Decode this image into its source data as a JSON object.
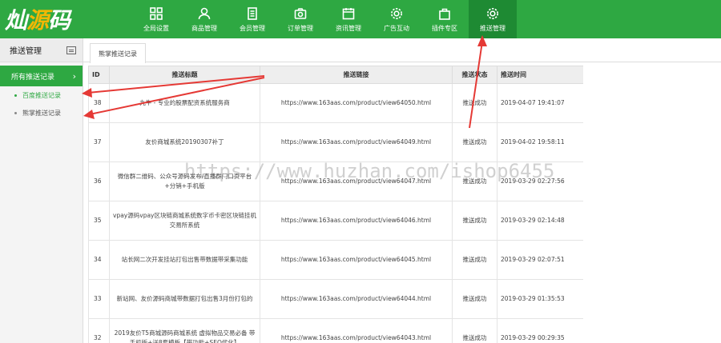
{
  "logo": {
    "part1": "灿",
    "part2": "源",
    "part3": "码"
  },
  "nav": [
    {
      "label": "全局设置",
      "icon": "grid-icon",
      "active": false
    },
    {
      "label": "商品管理",
      "icon": "user-icon",
      "active": false
    },
    {
      "label": "会员管理",
      "icon": "document-icon",
      "active": false
    },
    {
      "label": "订单管理",
      "icon": "camera-icon",
      "active": false
    },
    {
      "label": "资讯管理",
      "icon": "calendar-icon",
      "active": false
    },
    {
      "label": "广告互动",
      "icon": "gear-icon",
      "active": false
    },
    {
      "label": "插件专区",
      "icon": "bag-icon",
      "active": false
    },
    {
      "label": "推送管理",
      "icon": "gear-icon",
      "active": true
    }
  ],
  "sidebar": {
    "title": "推送管理",
    "group_label": "所有推送记录",
    "items": [
      {
        "label": "百度推送记录",
        "active": true
      },
      {
        "label": "熊掌推送记录",
        "active": false
      }
    ]
  },
  "tab": {
    "label": "熊掌推送记录"
  },
  "table": {
    "headers": [
      "ID",
      "推送标题",
      "推送链接",
      "推送状态",
      "推送时间"
    ],
    "rows": [
      {
        "id": "38",
        "title": "九牛 - 专业的股票配资系统服务商",
        "link": "https://www.163aas.com/product/view64050.html",
        "status": "推送成功",
        "time": "2019-04-07 19:41:07"
      },
      {
        "id": "37",
        "title": "友价商城系统20190307补丁",
        "link": "https://www.163aas.com/product/view64049.html",
        "status": "推送成功",
        "time": "2019-04-02 19:58:11"
      },
      {
        "id": "36",
        "title": "微信群二维码、公众号源码发布/直播群门口页平台+分销+手机版",
        "link": "https://www.163aas.com/product/view64047.html",
        "status": "推送成功",
        "time": "2019-03-29 02:27:56"
      },
      {
        "id": "35",
        "title": "vpay源码vpay区块链商城系统数字币卡密区块链挂机交易所系统",
        "link": "https://www.163aas.com/product/view64046.html",
        "status": "推送成功",
        "time": "2019-03-29 02:14:48"
      },
      {
        "id": "34",
        "title": "站长网二次开发挂站打包出售带数据带采集功能",
        "link": "https://www.163aas.com/product/view64045.html",
        "status": "推送成功",
        "time": "2019-03-29 02:07:51"
      },
      {
        "id": "33",
        "title": "新站网、友价源码商城带数据打包出售3月份打包的",
        "link": "https://www.163aas.com/product/view64044.html",
        "status": "推送成功",
        "time": "2019-03-29 01:35:53"
      },
      {
        "id": "32",
        "title": "2019友价T5商城源码商城系统 虚拟物品交易必备 带手机版+送8套模板【带功能+SEO优化】",
        "link": "https://www.163aas.com/product/view64043.html",
        "status": "推送成功",
        "time": "2019-03-29 00:29:35"
      }
    ]
  },
  "watermark": "https://www.huzhan.com/ishop6455",
  "colors": {
    "brand": "#2ea842",
    "brand_dark": "#1e8a33",
    "logo_accent": "#f2b705",
    "annotation": "#e53935"
  }
}
